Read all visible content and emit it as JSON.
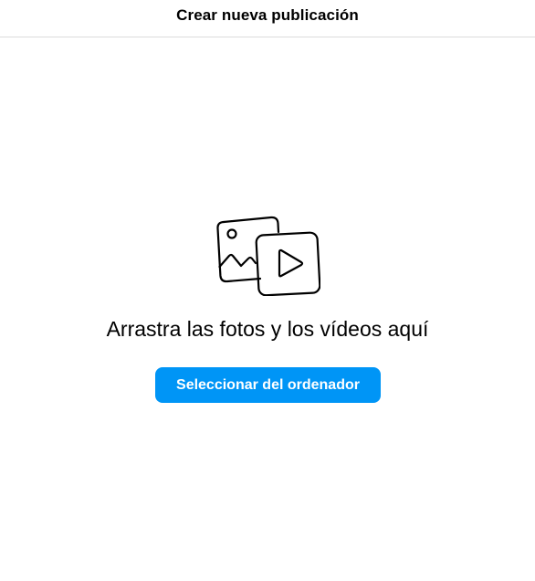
{
  "modal": {
    "title": "Crear nueva publicación",
    "drop_text": "Arrastra las fotos y los vídeos aquí",
    "select_button_label": "Seleccionar del ordenador",
    "media_icon": "photo-video-icon",
    "accent_color": "#0095f6"
  }
}
